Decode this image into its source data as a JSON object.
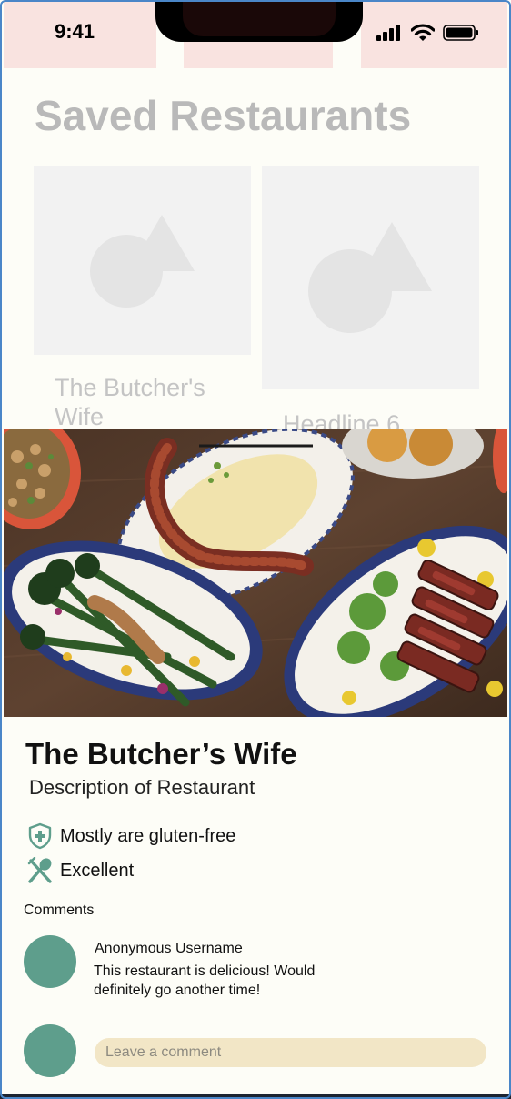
{
  "status_bar": {
    "time": "9:41"
  },
  "page": {
    "title": "Saved Restaurants"
  },
  "cards": [
    {
      "title": "The Butcher's Wife"
    },
    {
      "title": "Headline 6"
    }
  ],
  "detail": {
    "name": "The Butcher’s Wife",
    "description": "Description of Restaurant",
    "dietary": "Mostly are gluten-free",
    "rating": "Excellent"
  },
  "comments": {
    "label": "Comments",
    "items": [
      {
        "username": "Anonymous Username",
        "text": "This restaurant is delicious! Would definitely go another time!"
      }
    ],
    "input_placeholder": "Leave a comment"
  },
  "colors": {
    "accent": "#5e9e8c",
    "input_bg": "#f2e6c6",
    "status_pad": "#f9e3e0",
    "background": "#fdfdf7"
  }
}
